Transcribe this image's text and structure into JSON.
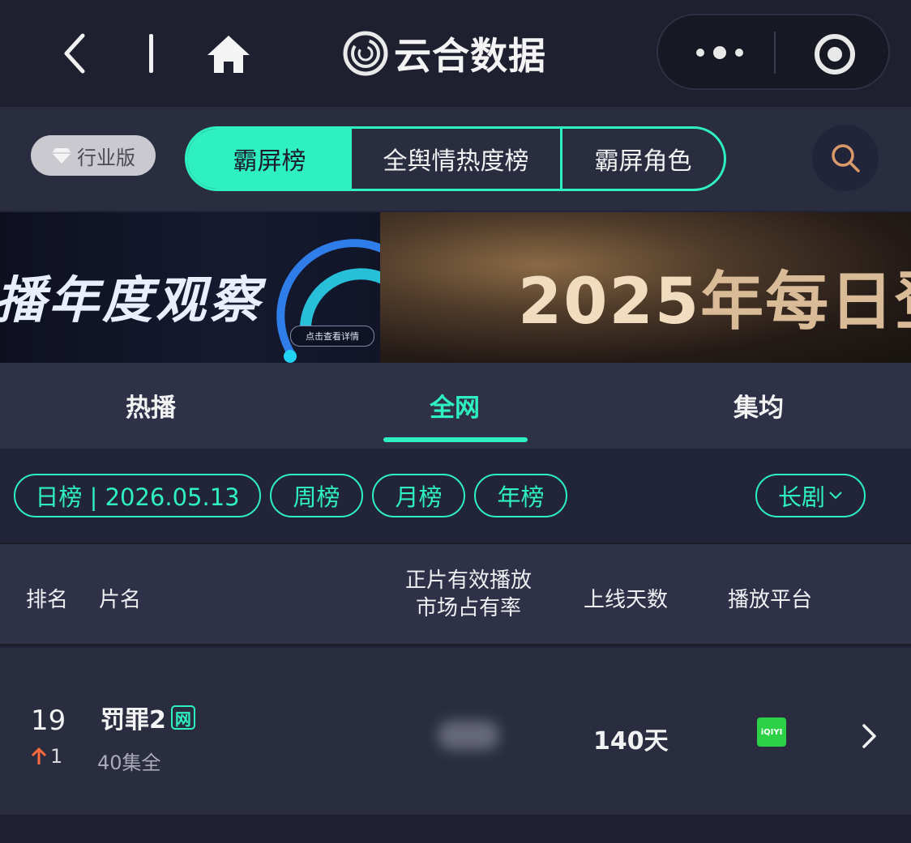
{
  "app": {
    "title": "云合数据"
  },
  "filters": {
    "industry_label": "行业版",
    "segments": [
      "霸屏榜",
      "全舆情热度榜",
      "霸屏角色"
    ]
  },
  "banners": {
    "left_text": "播年度观察",
    "left_button": "点击查看详情",
    "right_year": "2025",
    "right_text": "年每日登顶"
  },
  "tabs": [
    "热播",
    "全网",
    "集均"
  ],
  "chips": {
    "daily": "日榜 | 2026.05.13",
    "weekly": "周榜",
    "monthly": "月榜",
    "yearly": "年榜",
    "category": "长剧"
  },
  "table": {
    "headers": {
      "rank": "排名",
      "title": "片名",
      "share_line1": "正片有效播放",
      "share_line2": "市场占有率",
      "days": "上线天数",
      "platform": "播放平台"
    },
    "rows": [
      {
        "rank": "19",
        "change": "1",
        "title": "罚罪2",
        "badge": "网",
        "episodes": "40集全",
        "days": "140天",
        "platform": "iQIYI"
      }
    ]
  },
  "colors": {
    "accent": "#2ef0c0",
    "up_arrow": "#ff6a3d",
    "iqiyi": "#2dd145"
  }
}
